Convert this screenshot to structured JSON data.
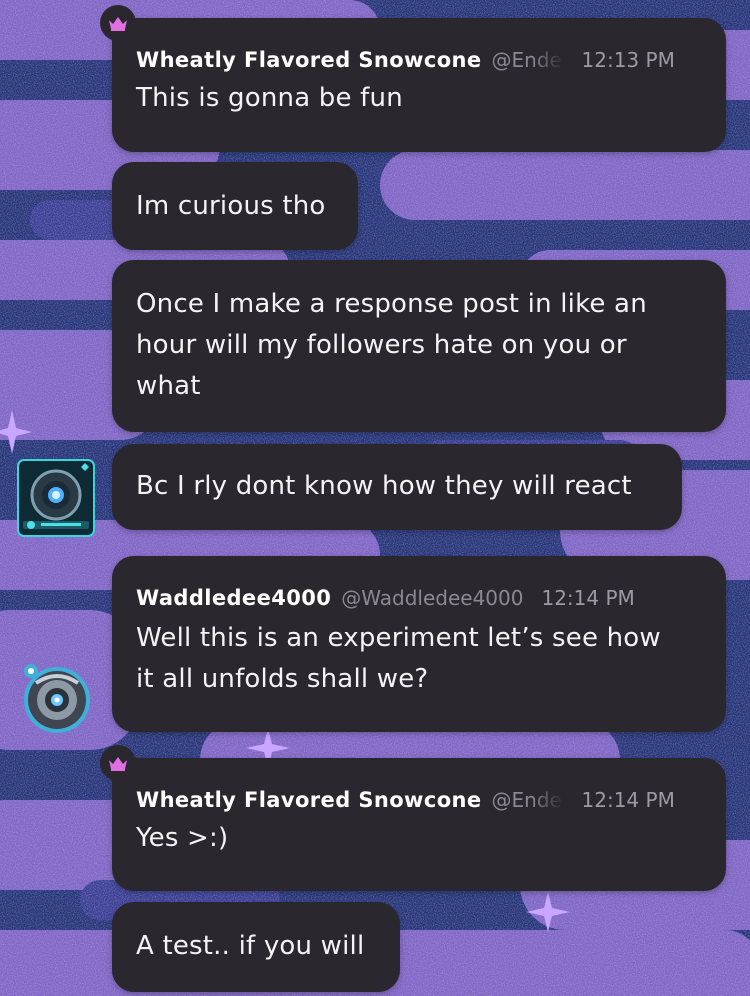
{
  "colors": {
    "background_blue": "#1f2f72",
    "background_purple": "#8a6cc8",
    "bubble": "#2a272e",
    "crown": "#e070e0",
    "handle": "#8b8893"
  },
  "messages": [
    {
      "id": "m1",
      "author": "Wheatly Flavored Snowcone",
      "handle": "@EnderWheatley",
      "time": "12:13 PM",
      "text": "This is gonna be fun"
    },
    {
      "id": "m2",
      "text": "Im curious tho"
    },
    {
      "id": "m3",
      "lines": [
        "Once I make a response post in like an",
        "hour will my followers hate on you or",
        "what"
      ]
    },
    {
      "id": "m4",
      "text": "Bc I rly dont know how they will react"
    },
    {
      "id": "m5",
      "author": "Waddledee4000",
      "handle": "@Waddledee4000",
      "time": "12:14 PM",
      "lines": [
        "Well this is an experiment let’s see how",
        "it all unfolds shall we?"
      ]
    },
    {
      "id": "m6",
      "author": "Wheatly Flavored Snowcone",
      "handle": "@EnderWheatley",
      "time": "12:14 PM",
      "text": "Yes >:)"
    },
    {
      "id": "m7",
      "text": "A test.. if you will"
    }
  ],
  "icons": {
    "crown": "crown-icon",
    "avatar_wheatley": "wheatley-robot-avatar",
    "avatar_waddledee": "waddledee-robot-avatar"
  }
}
